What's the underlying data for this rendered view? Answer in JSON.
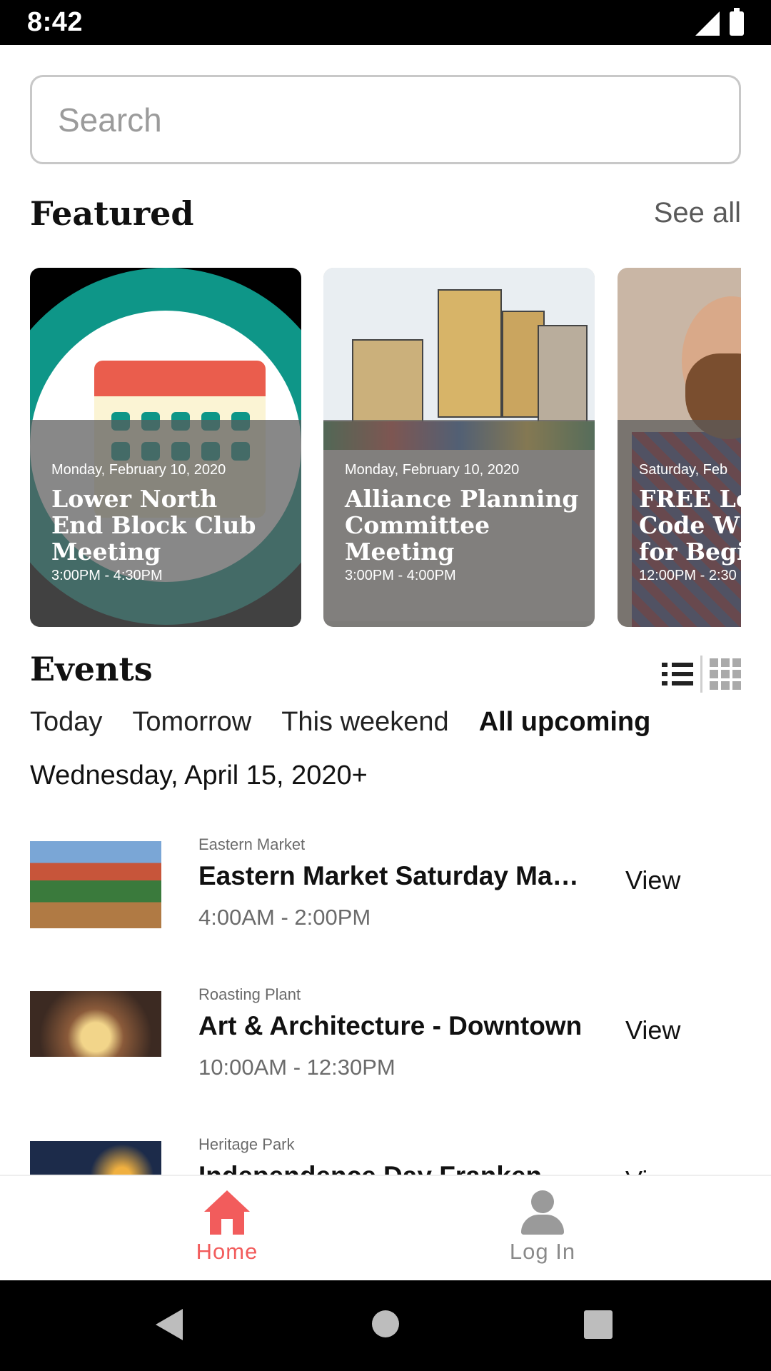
{
  "status_bar": {
    "time": "8:42",
    "icons": [
      "signal-icon",
      "battery-icon"
    ]
  },
  "search": {
    "placeholder": "Search",
    "value": ""
  },
  "featured": {
    "title": "Featured",
    "see_all": "See all",
    "cards": [
      {
        "date": "Monday, February 10, 2020",
        "title_lines": [
          "Lower North",
          "End Block Club",
          "Meeting"
        ],
        "time": "3:00PM - 4:30PM"
      },
      {
        "date": "Monday, February 10, 2020",
        "title_lines": [
          "Alliance Planning",
          "Committee",
          "Meeting"
        ],
        "time": "3:00PM - 4:00PM"
      },
      {
        "date": "Saturday, Feb",
        "title_lines": [
          "FREE Le",
          "Code W",
          "for Begi"
        ],
        "time": "12:00PM - 2:30"
      }
    ]
  },
  "events": {
    "title": "Events",
    "tabs": [
      "Today",
      "Tomorrow",
      "This weekend",
      "All upcoming"
    ],
    "active_tab": "All upcoming",
    "date_heading": "Wednesday, April 15, 2020+",
    "items": [
      {
        "venue": "Eastern Market",
        "title": "Eastern Market Saturday Market",
        "time": "4:00AM - 2:00PM",
        "action": "View"
      },
      {
        "venue": "Roasting Plant",
        "title": "Art & Architecture - Downtown",
        "time": "10:00AM - 12:30PM",
        "action": "View"
      },
      {
        "venue": "Heritage Park",
        "title": "Independence Day Frankenmuth",
        "time": "",
        "action": "View"
      }
    ]
  },
  "bottom_nav": {
    "home": "Home",
    "login": "Log In"
  },
  "colors": {
    "accent": "#f25c5c",
    "teal": "#0e9688"
  }
}
